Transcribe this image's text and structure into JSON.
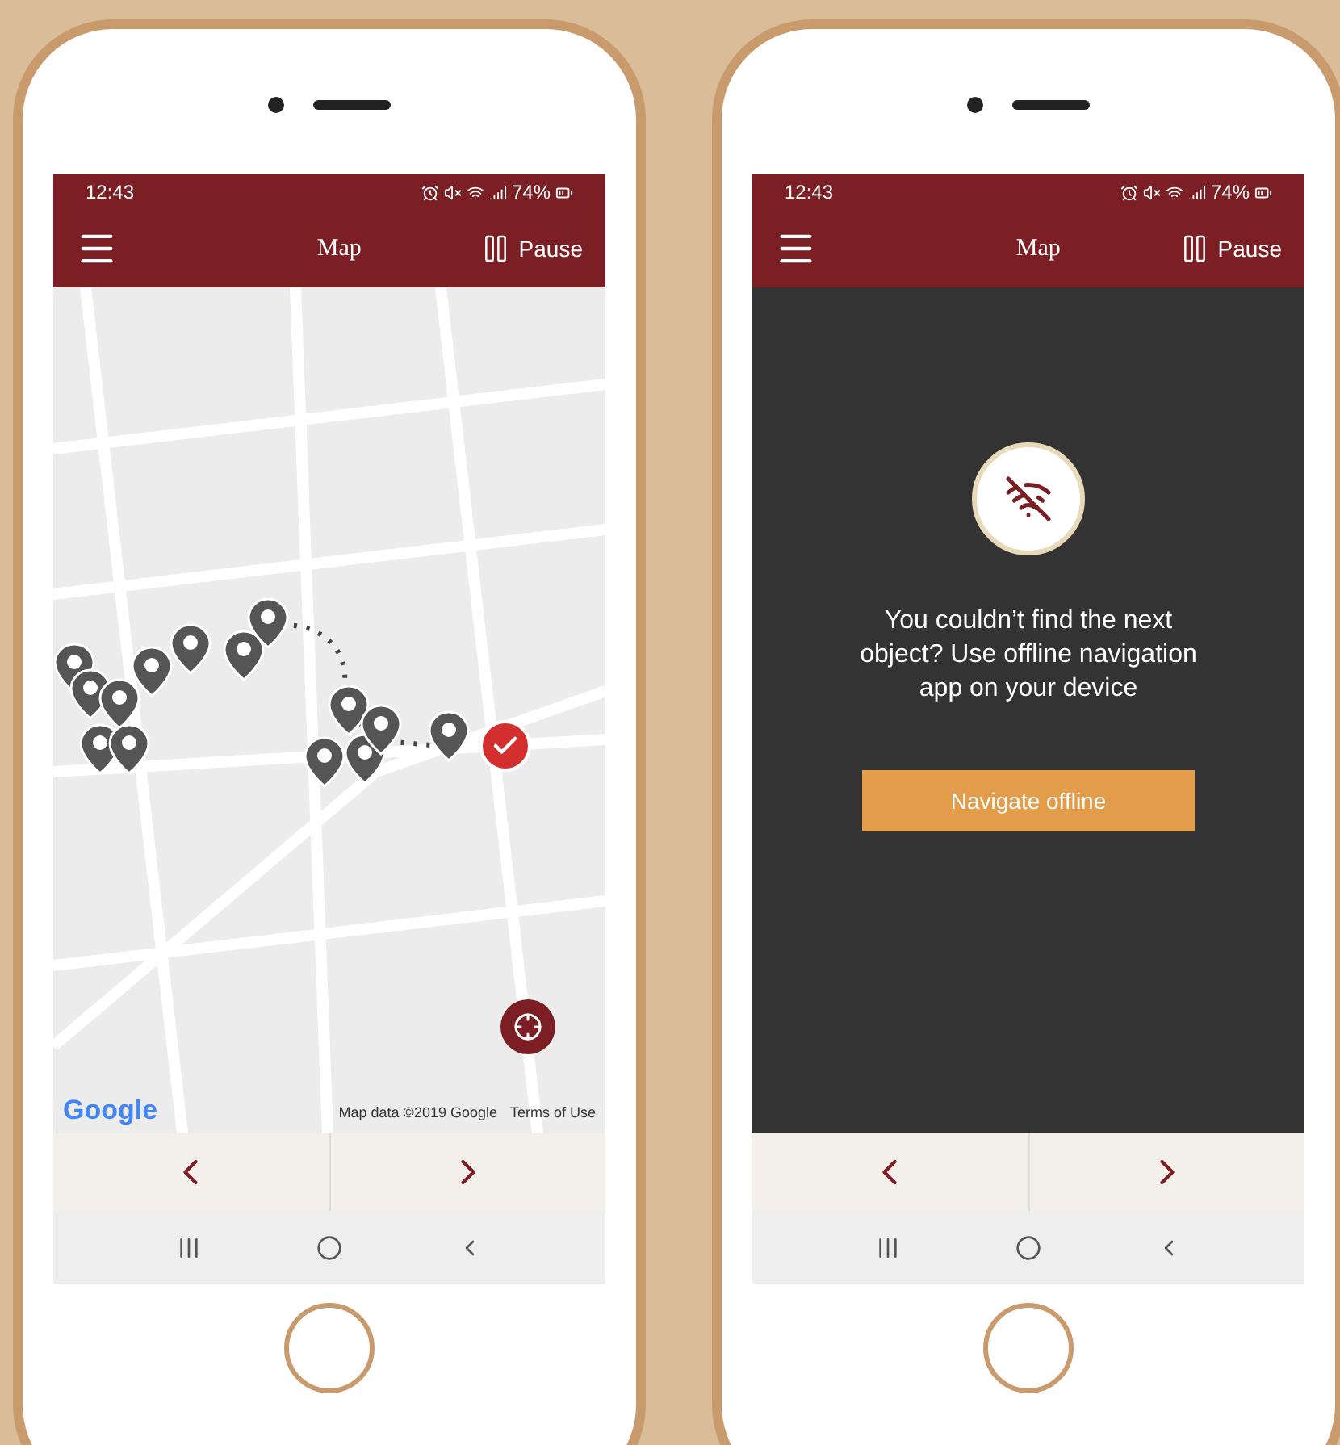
{
  "phones": [
    {
      "status_bar": {
        "time": "12:43",
        "battery": "74%"
      },
      "header": {
        "title": "Map",
        "action": "Pause"
      },
      "screen": {
        "kind": "map",
        "logo": "Google",
        "attribution": "Map data ©2019 Google",
        "terms": "Terms of Use"
      }
    },
    {
      "status_bar": {
        "time": "12:43",
        "battery": "74%"
      },
      "header": {
        "title": "Map",
        "action": "Pause"
      },
      "screen": {
        "kind": "offline",
        "message": "You couldn’t find the next object? Use offline navigation app on your device",
        "button": "Navigate offline"
      }
    }
  ]
}
